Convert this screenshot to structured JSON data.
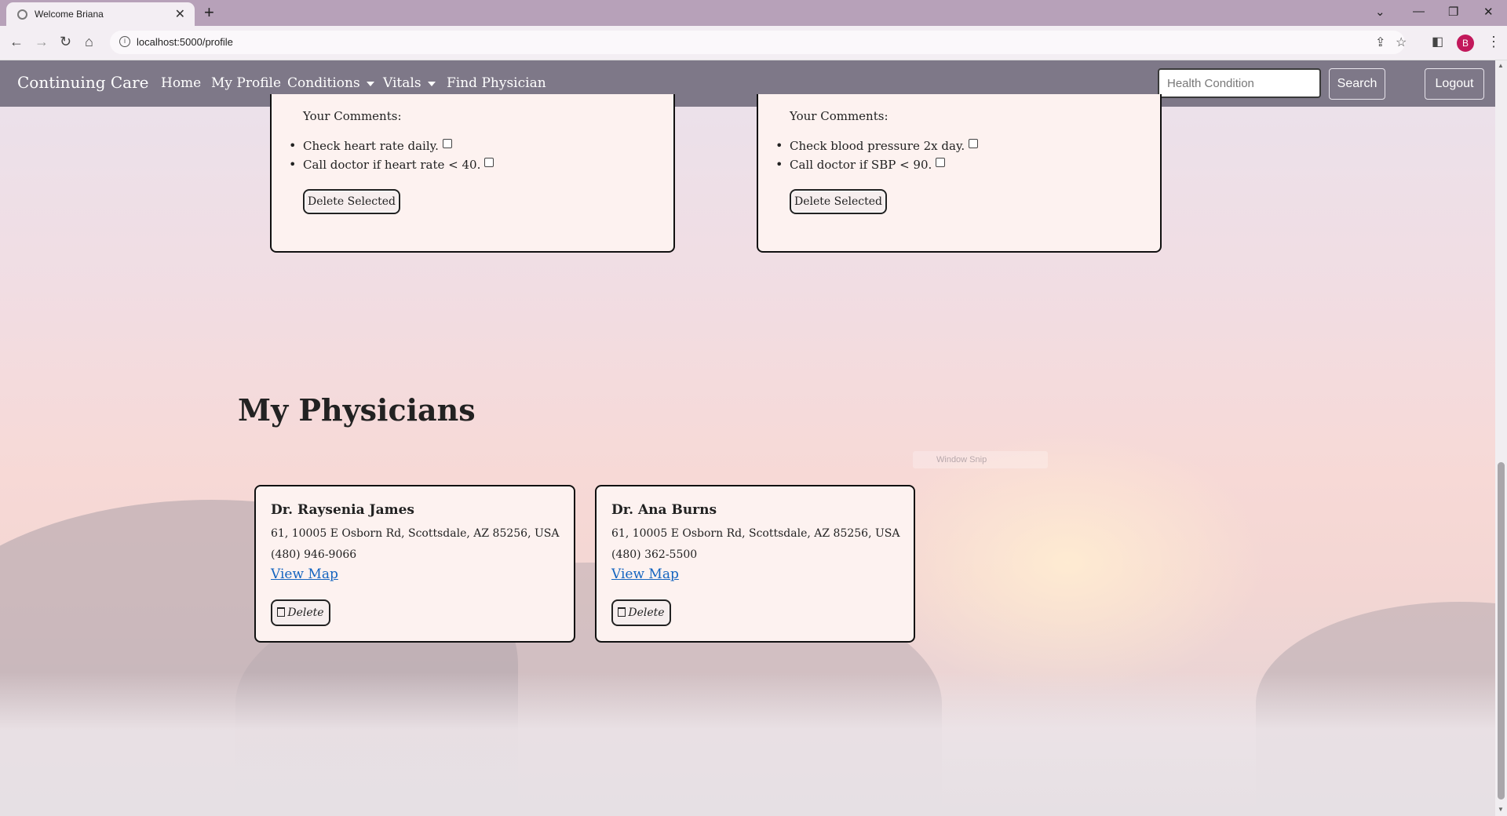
{
  "browser": {
    "tab_title": "Welcome Briana",
    "url": "localhost:5000/profile",
    "profile_initial": "B"
  },
  "navbar": {
    "brand": "Continuing Care",
    "links": [
      "Home",
      "My Profile",
      "Conditions",
      "Vitals",
      "Find Physician"
    ],
    "search_placeholder": "Health Condition",
    "search_label": "Search",
    "logout_label": "Logout"
  },
  "conditions": [
    {
      "comments_label": "Your Comments:",
      "comments": [
        "Check heart rate daily.",
        "Call doctor if heart rate < 40."
      ],
      "delete_label": "Delete Selected"
    },
    {
      "comments_label": "Your Comments:",
      "comments": [
        "Check blood pressure 2x day.",
        "Call doctor if SBP < 90."
      ],
      "delete_label": "Delete Selected"
    }
  ],
  "physicians_title": "My Physicians",
  "physicians": [
    {
      "name": "Dr. Raysenia James",
      "address": "61, 10005 E Osborn Rd, Scottsdale, AZ 85256, USA",
      "phone": "(480) 946-9066",
      "map_label": "View Map",
      "delete_label": "Delete"
    },
    {
      "name": "Dr. Ana Burns",
      "address": "61, 10005 E Osborn Rd, Scottsdale, AZ 85256, USA",
      "phone": "(480) 362-5500",
      "map_label": "View Map",
      "delete_label": "Delete"
    }
  ],
  "overlay_text": "Window Snip",
  "icons": [
    "back-arrow-icon",
    "forward-arrow-icon",
    "reload-icon",
    "home-icon",
    "info-icon",
    "share-icon",
    "star-icon",
    "sidepanel-icon",
    "menu-dots-icon",
    "trash-icon"
  ]
}
